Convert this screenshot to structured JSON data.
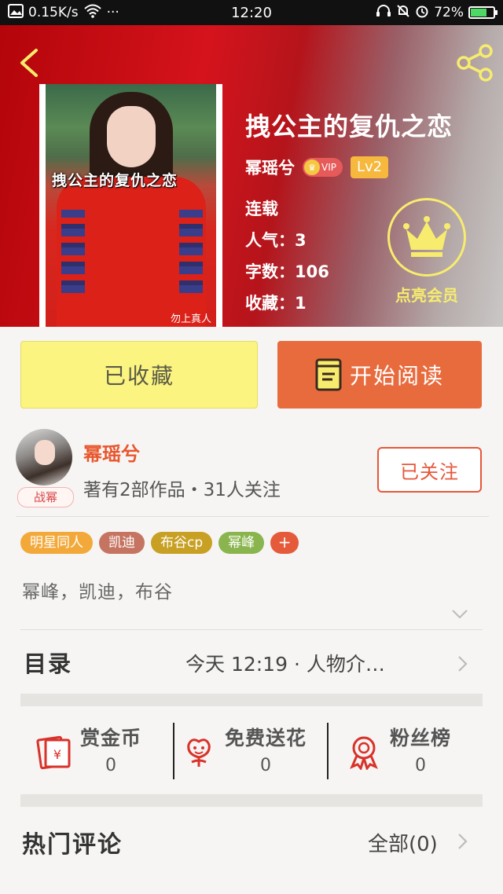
{
  "status_bar": {
    "network_speed": "0.15K/s",
    "more": "···",
    "time": "12:20",
    "battery": "72%",
    "battery_level": 0.72
  },
  "book": {
    "title": "拽公主的复仇之恋",
    "cover_title": "拽公主的复仇之恋",
    "cover_sign": "勿上真人",
    "author": "幂瑶兮",
    "vip_label": "VIP",
    "level": "Lv2",
    "status": "连载",
    "popularity": "人气：3",
    "word_count": "字数：106",
    "favorites": "收藏：1",
    "member_label": "点亮会员"
  },
  "actions": {
    "collected": "已收藏",
    "start_reading": "开始阅读"
  },
  "author_card": {
    "avatar_tag": "战幂",
    "name": "幂瑶兮",
    "stats": "著有2部作品・31人关注",
    "follow_label": "已关注"
  },
  "tags": [
    {
      "label": "明星同人",
      "color": "#f3a93a"
    },
    {
      "label": "凯迪",
      "color": "#c57461"
    },
    {
      "label": "布谷cp",
      "color": "#c8a024"
    },
    {
      "label": "幂峰",
      "color": "#8ab54e"
    }
  ],
  "tag_add": "+",
  "description": "幂峰，凯迪，布谷",
  "toc": {
    "label": "目录",
    "meta": "今天 12:19 · 人物介…"
  },
  "rewards": [
    {
      "label": "赏金币",
      "value": "0",
      "icon": "red-envelope-icon"
    },
    {
      "label": "免费送花",
      "value": "0",
      "icon": "flower-icon"
    },
    {
      "label": "粉丝榜",
      "value": "0",
      "icon": "medal-icon"
    }
  ],
  "comments": {
    "label": "热门评论",
    "all": "全部(0)"
  },
  "colors": {
    "accent_orange": "#e86b3e",
    "collected_yellow": "#fbf481",
    "member_gold": "#f7ec6e",
    "follow_red": "#e6573a"
  }
}
